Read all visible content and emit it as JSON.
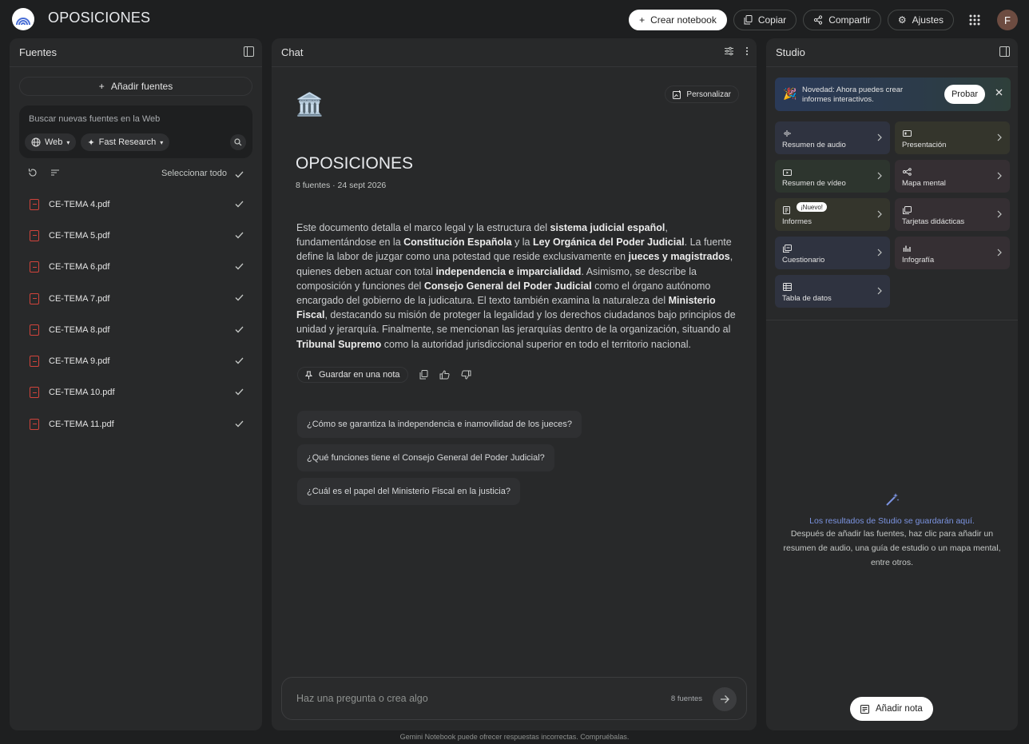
{
  "topbar": {
    "title": "OPOSICIONES",
    "create_label": "Crear notebook",
    "copy_label": "Copiar",
    "share_label": "Compartir",
    "settings_label": "Ajustes",
    "avatar_letter": "F"
  },
  "sources": {
    "title": "Fuentes",
    "add_label": "Añadir fuentes",
    "search_placeholder": "Buscar nuevas fuentes en la Web",
    "web_chip": "Web",
    "research_chip": "Fast Research",
    "select_all": "Seleccionar todo",
    "items": [
      {
        "name": "CE-TEMA 4.pdf",
        "checked": true
      },
      {
        "name": "CE-TEMA 5.pdf",
        "checked": true
      },
      {
        "name": "CE-TEMA 6.pdf",
        "checked": true
      },
      {
        "name": "CE-TEMA 7.pdf",
        "checked": true
      },
      {
        "name": "CE-TEMA 8.pdf",
        "checked": true
      },
      {
        "name": "CE-TEMA 9.pdf",
        "checked": true
      },
      {
        "name": "CE-TEMA 10.pdf",
        "checked": true
      },
      {
        "name": "CE-TEMA 11.pdf",
        "checked": true
      }
    ]
  },
  "chat": {
    "title": "Chat",
    "personalize_label": "Personalizar",
    "emoji": "🏛️",
    "notebook_title": "OPOSICIONES",
    "meta": "8 fuentes · 24 sept 2026",
    "summary_parts": [
      {
        "t": "Este documento detalla el marco legal y la estructura del ",
        "b": false
      },
      {
        "t": "sistema judicial español",
        "b": true
      },
      {
        "t": ", fundamentándose en la ",
        "b": false
      },
      {
        "t": "Constitución Española",
        "b": true
      },
      {
        "t": " y la ",
        "b": false
      },
      {
        "t": "Ley Orgánica del Poder Judicial",
        "b": true
      },
      {
        "t": ". La fuente define la labor de juzgar como una potestad que reside exclusivamente en ",
        "b": false
      },
      {
        "t": "jueces y magistrados",
        "b": true
      },
      {
        "t": ", quienes deben actuar con total ",
        "b": false
      },
      {
        "t": "independencia e imparcialidad",
        "b": true
      },
      {
        "t": ". Asimismo, se describe la composición y funciones del ",
        "b": false
      },
      {
        "t": "Consejo General del Poder Judicial",
        "b": true
      },
      {
        "t": " como el órgano autónomo encargado del gobierno de la judicatura. El texto también examina la naturaleza del ",
        "b": false
      },
      {
        "t": "Ministerio Fiscal",
        "b": true
      },
      {
        "t": ", destacando su misión de proteger la legalidad y los derechos ciudadanos bajo principios de unidad y jerarquía. Finalmente, se mencionan las jerarquías dentro de la organización, situando al ",
        "b": false
      },
      {
        "t": "Tribunal Supremo",
        "b": true
      },
      {
        "t": " como la autoridad jurisdiccional superior en todo el territorio nacional.",
        "b": false
      }
    ],
    "save_note_label": "Guardar en una nota",
    "suggestions": [
      "¿Cómo se garantiza la independencia e inamovilidad de los jueces?",
      "¿Qué funciones tiene el Consejo General del Poder Judicial?",
      "¿Cuál es el papel del Ministerio Fiscal en la justicia?"
    ],
    "input_placeholder": "Haz una pregunta o crea algo",
    "source_count": "8 fuentes"
  },
  "studio": {
    "title": "Studio",
    "promo_text": "Novedad: Ahora puedes crear informes interactivos.",
    "promo_button": "Probar",
    "tiles": [
      {
        "label": "Resumen de audio",
        "icon": "audio-icon",
        "tone": "t-blue"
      },
      {
        "label": "Presentación",
        "icon": "slides-icon",
        "tone": "t-olive"
      },
      {
        "label": "Resumen de vídeo",
        "icon": "video-icon",
        "tone": "t-green"
      },
      {
        "label": "Mapa mental",
        "icon": "mindmap-icon",
        "tone": "t-mauve"
      },
      {
        "label": "Informes",
        "icon": "reports-icon",
        "tone": "t-olive",
        "badge": "¡Nuevo!"
      },
      {
        "label": "Tarjetas didácticas",
        "icon": "flashcards-icon",
        "tone": "t-mauve"
      },
      {
        "label": "Cuestionario",
        "icon": "quiz-icon",
        "tone": "t-blue"
      },
      {
        "label": "Infografía",
        "icon": "infographic-icon",
        "tone": "t-mauve"
      },
      {
        "label": "Tabla de datos",
        "icon": "table-icon",
        "tone": "t-blue"
      }
    ],
    "empty_title": "Los resultados de Studio se guardarán aquí.",
    "empty_desc": "Después de añadir las fuentes, haz clic para añadir un resumen de audio, una guía de estudio o un mapa mental, entre otros.",
    "add_note_label": "Añadir nota"
  },
  "footer": "Gemini Notebook puede ofrecer respuestas incorrectas. Compruébalas.",
  "colors": {
    "accent": "#7b93e0",
    "pdf": "#d0433b",
    "bg": "#1e1f20",
    "panel": "#28292a"
  }
}
